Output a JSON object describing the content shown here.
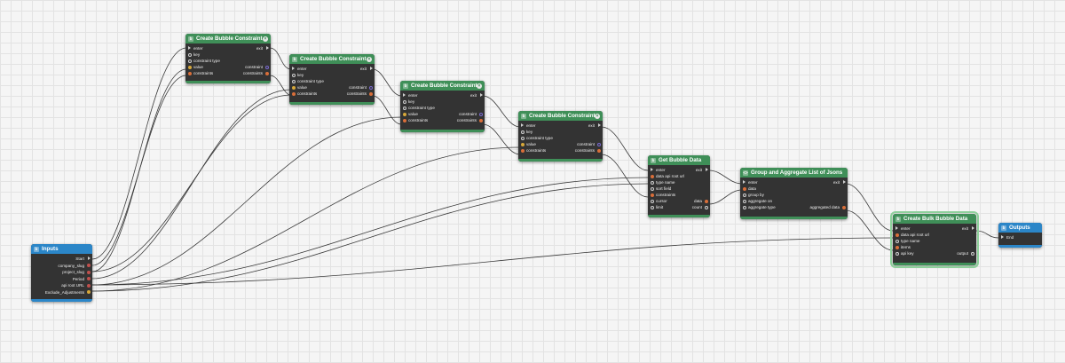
{
  "colors": {
    "wire": "#3a3a3a",
    "header_green": "#3f8f58",
    "header_blue": "#2b86c8",
    "node_body": "#333333"
  },
  "nodes": {
    "inputs": {
      "title": "Inputs",
      "icon": "bubble-icon",
      "outputs": [
        "Start",
        "company_slug",
        "project_slug",
        "Period",
        "api root URL",
        "Exclude_Adjustments"
      ]
    },
    "c1": {
      "title": "Create Bubble Constraint",
      "icon": "bubble-icon",
      "inputs": [
        "enter",
        "key",
        "constraint type",
        "value",
        "constraints"
      ],
      "outputs": [
        "exit",
        "constraint",
        "constraints"
      ]
    },
    "c2": {
      "title": "Create Bubble Constraint",
      "icon": "bubble-icon",
      "inputs": [
        "enter",
        "key",
        "constraint type",
        "value",
        "constraints"
      ],
      "outputs": [
        "exit",
        "constraint",
        "constraints"
      ]
    },
    "c3": {
      "title": "Create Bubble Constraint",
      "icon": "bubble-icon",
      "inputs": [
        "enter",
        "key",
        "constraint type",
        "value",
        "constraints"
      ],
      "outputs": [
        "exit",
        "constraint",
        "constraints"
      ]
    },
    "c4": {
      "title": "Create Bubble Constraint",
      "icon": "bubble-icon",
      "inputs": [
        "enter",
        "key",
        "constraint type",
        "value",
        "constraints"
      ],
      "outputs": [
        "exit",
        "constraint",
        "constraints"
      ]
    },
    "get": {
      "title": "Get Bubble Data",
      "icon": "bubble-icon",
      "inputs": [
        "enter",
        "data api root url",
        "type name",
        "sort field",
        "constraints",
        "cursor",
        "limit"
      ],
      "outputs": [
        "exit",
        "data",
        "count"
      ]
    },
    "group": {
      "title": "Group and Aggregate List of Jsons",
      "icon": "code-icon",
      "inputs": [
        "enter",
        "data",
        "group by",
        "aggregate on",
        "aggregate type"
      ],
      "outputs": [
        "exit",
        "aggregated data"
      ]
    },
    "bulk": {
      "title": "Create Bulk Bubble Data",
      "icon": "bubble-icon",
      "inputs": [
        "enter",
        "data api root url",
        "type name",
        "items",
        "api key"
      ],
      "outputs": [
        "exit",
        "output"
      ]
    },
    "outputs": {
      "title": "Outputs",
      "icon": "bubble-icon",
      "inputs": [
        "End"
      ]
    }
  }
}
